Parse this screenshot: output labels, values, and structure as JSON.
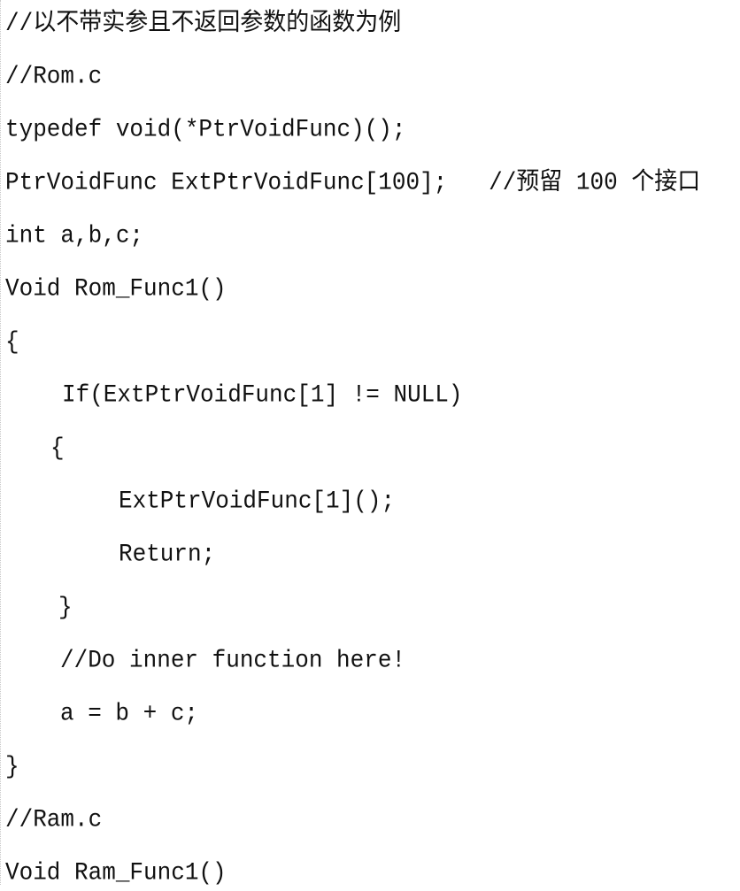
{
  "document": {
    "lines": [
      {
        "text": "//以不带实参且不返回参数的函数为例",
        "indent": 0
      },
      {
        "text": "//Rom.c",
        "indent": 0
      },
      {
        "text": "typedef void(*PtrVoidFunc)();",
        "indent": 0
      },
      {
        "text": "PtrVoidFunc ExtPtrVoidFunc[100];   //预留 100 个接口",
        "indent": 0
      },
      {
        "text": "int a,b,c;",
        "indent": 0
      },
      {
        "text": "Void Rom_Func1()",
        "indent": 0
      },
      {
        "text": "{",
        "indent": 0
      },
      {
        "text": "If(ExtPtrVoidFunc[1] != NULL)",
        "indent": 4
      },
      {
        "text": "{",
        "indent": 3.5
      },
      {
        "text": "ExtPtrVoidFunc[1]();",
        "indent": 8
      },
      {
        "text": "Return;",
        "indent": 8
      },
      {
        "text": "}",
        "indent": 4
      },
      {
        "text": "//Do inner function here!",
        "indent": 4
      },
      {
        "text": "a = b + c;",
        "indent": 4
      },
      {
        "text": "}",
        "indent": 0
      },
      {
        "text": "//Ram.c",
        "indent": 0
      },
      {
        "text": "Void Ram_Func1()",
        "indent": 0
      }
    ]
  }
}
